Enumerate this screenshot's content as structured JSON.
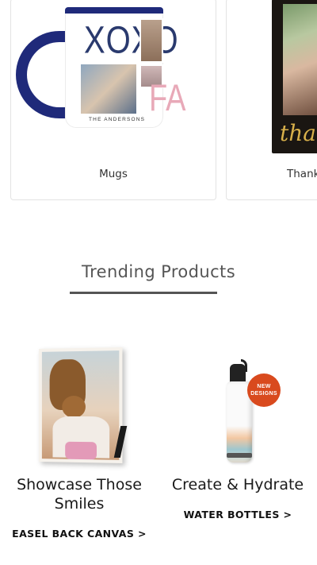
{
  "categories": [
    {
      "label": "Mugs",
      "mug_text": "XOXO",
      "mug_accent": "FA",
      "mug_caption": "THE ANDERSONS"
    },
    {
      "label": "Thank",
      "card_script": "tha"
    }
  ],
  "trending": {
    "title": "Trending Products"
  },
  "products": [
    {
      "title": "Showcase Those Smiles",
      "link": "EASEL BACK CANVAS >"
    },
    {
      "title": "Create & Hydrate",
      "link": "WATER BOTTLES >",
      "badge": "NEW DESIGNS"
    }
  ],
  "colors": {
    "mug_navy": "#1f2a7a",
    "badge_orange": "#d94a1e",
    "underline": "#555555"
  }
}
